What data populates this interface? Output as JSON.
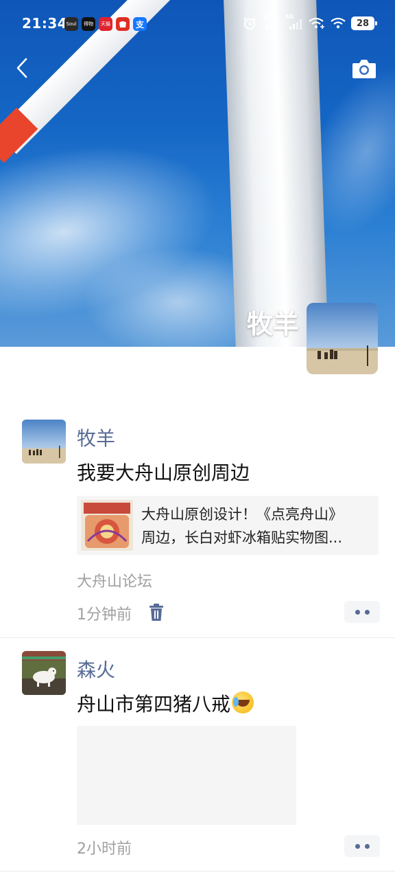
{
  "status_bar": {
    "time": "21:34",
    "app_icons": [
      {
        "name": "soul-icon",
        "label": "Soul",
        "color": "#1a1a1a"
      },
      {
        "name": "dewu-icon",
        "label": "得物",
        "color": "#111111"
      },
      {
        "name": "tmall-icon",
        "label": "天猫",
        "color": "#e0222d"
      },
      {
        "name": "pinduoduo-icon",
        "label": "",
        "color": "#e02e24"
      },
      {
        "name": "alipay-icon",
        "label": "支",
        "color": "#1677ff"
      }
    ],
    "signal_label_1": "5G",
    "signal_label_2": "5G",
    "battery": "28"
  },
  "header": {
    "profile_name": "牧羊"
  },
  "posts": [
    {
      "username": "牧羊",
      "text": "我要大舟山原创周边",
      "link": {
        "title_line1": "大舟山原创设计！《点亮舟山》",
        "title_line2": "周边，长白对虾冰箱贴实物图..."
      },
      "source": "大舟山论坛",
      "time": "1分钟前"
    },
    {
      "username": "森火",
      "text": "舟山市第四猪八戒",
      "emoji": "laugh-cry-emoji",
      "time": "2小时前"
    }
  ],
  "colors": {
    "username": "#576b95",
    "meta_gray": "#a0a0a0",
    "card_bg": "#f5f5f5"
  }
}
